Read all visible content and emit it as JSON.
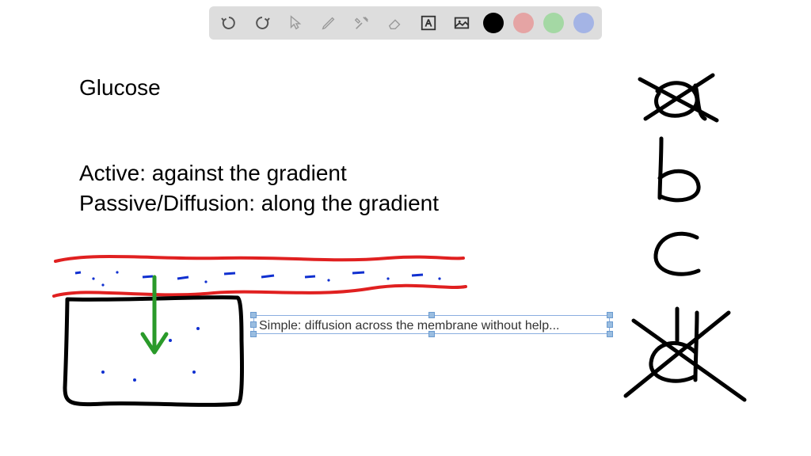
{
  "toolbar": {
    "swatches": [
      "#000000",
      "#e5a4a4",
      "#a4d8a4",
      "#a4b4e5"
    ]
  },
  "canvas": {
    "title": "Glucose",
    "line_active": "Active: against the gradient",
    "line_passive": "Passive/Diffusion: along the gradient",
    "textbox_text": "Simple: diffusion across the membrane without help..."
  },
  "colors": {
    "red_stroke": "#e02020",
    "blue_stroke": "#1030d0",
    "green_stroke": "#2a9a2a",
    "black_stroke": "#000000"
  }
}
